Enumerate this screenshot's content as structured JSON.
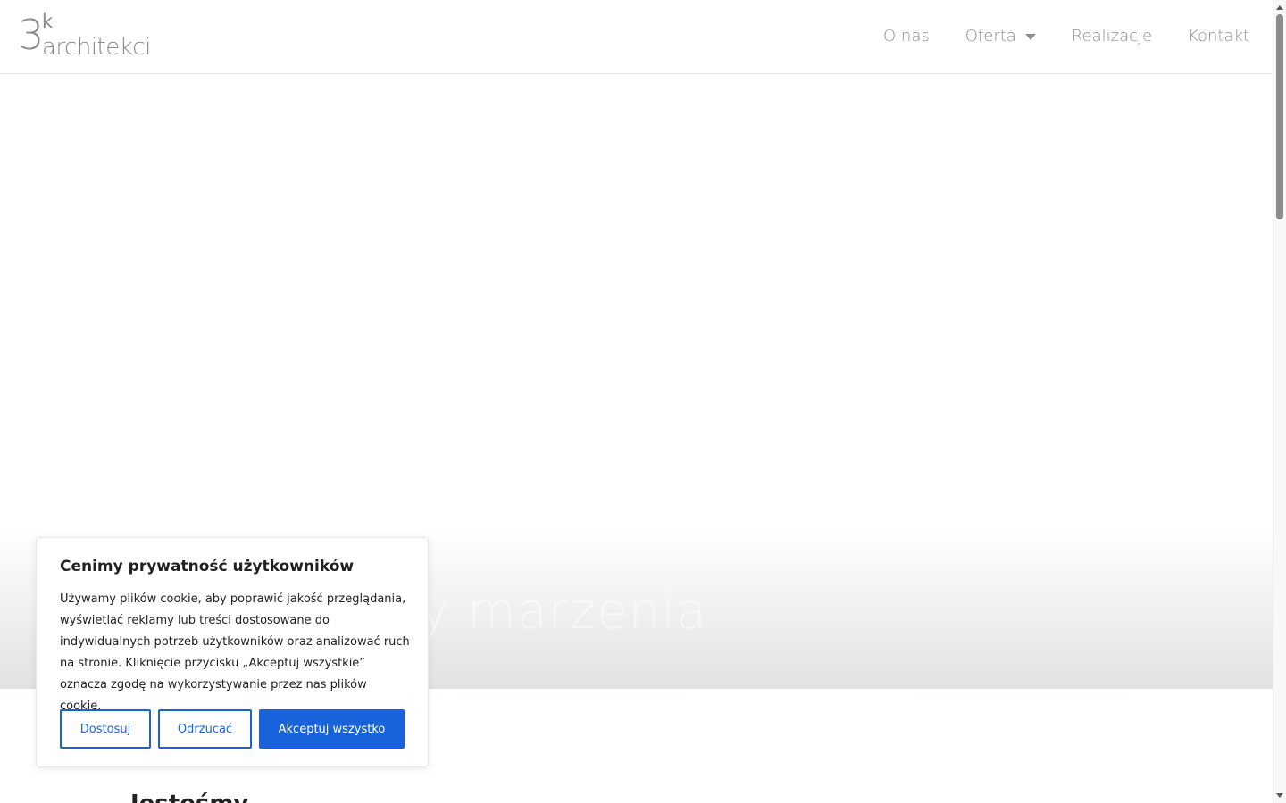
{
  "logo": {
    "number": "3",
    "superscript": "k",
    "word": "architekci"
  },
  "nav": {
    "items": [
      {
        "label": "O nas"
      },
      {
        "label": "Oferta"
      },
      {
        "label": "Realizacje"
      },
      {
        "label": "Kontakt"
      }
    ]
  },
  "hero": {
    "text": "y marzenia"
  },
  "section": {
    "heading_partial": "Jesteśmy"
  },
  "cookie": {
    "title": "Cenimy prywatność użytkowników",
    "text": "Używamy plików cookie, aby poprawić jakość przeglądania, wyświetlać reklamy lub treści dostosowane do indywidualnych potrzeb użytkowników oraz analizować ruch na stronie. Kliknięcie przycisku „Akceptuj wszystkie” oznacza zgodę na wykorzystywanie przez nas plików cookie.",
    "buttons": {
      "customize": "Dostosuj",
      "reject": "Odrzucać",
      "accept": "Akceptuj wszystko"
    }
  },
  "colors": {
    "accent": "#1863dc",
    "nav_text": "#8f8f8f",
    "logo": "#8a8a8a"
  }
}
